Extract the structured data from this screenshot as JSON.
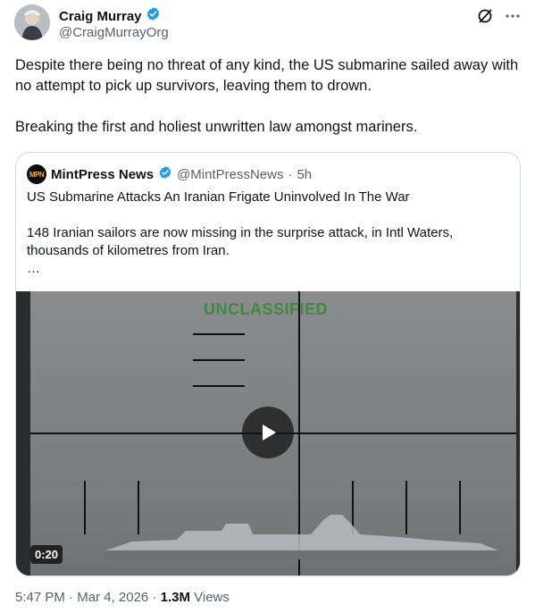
{
  "author": {
    "name": "Craig Murray",
    "handle": "@CraigMurrayOrg"
  },
  "tweet": {
    "paragraphs": [
      "Despite there being no threat of any kind, the US submarine sailed away with no attempt to pick up survivors, leaving them to drown.",
      "Breaking the first and holiest unwritten law amongst mariners."
    ]
  },
  "quoted": {
    "logo_text": "MPN",
    "name": "MintPress News",
    "handle": "@MintPressNews",
    "separator": "·",
    "time": "5h",
    "headline": "US Submarine Attacks An Iranian Frigate Uninvolved In The War",
    "body": "148 Iranian sailors are now missing in the surprise attack, in Intl Waters, thousands of kilometres from Iran.",
    "ellipsis": "…",
    "video": {
      "overlay_text": "UNCLASSIFIED",
      "duration": "0:20"
    }
  },
  "footer": {
    "time": "5:47 PM",
    "sep1": "·",
    "date": "Mar 4, 2026",
    "sep2": "·",
    "views_count": "1.3M",
    "views_label": "Views"
  },
  "colors": {
    "verified": "#1d9bf0",
    "text": "#0f1419",
    "muted": "#536471",
    "overlay_green": "#3f8a40"
  }
}
